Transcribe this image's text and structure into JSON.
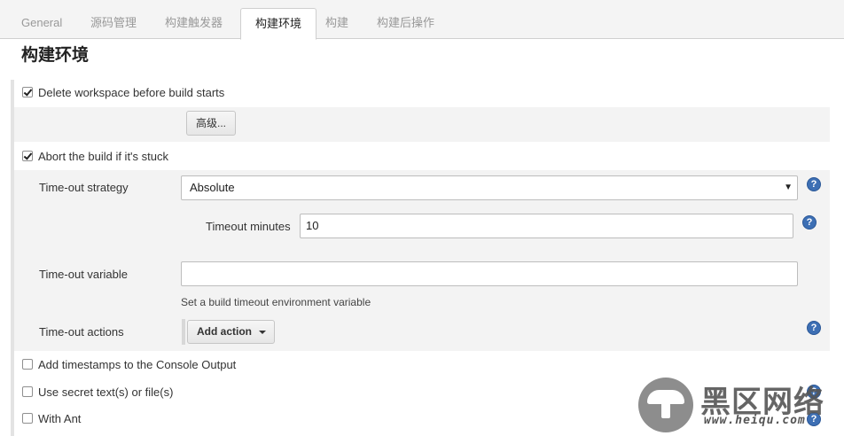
{
  "tabs": [
    {
      "label": "General"
    },
    {
      "label": "源码管理"
    },
    {
      "label": "构建触发器"
    },
    {
      "label": "构建环境"
    },
    {
      "label": "构建"
    },
    {
      "label": "构建后操作"
    }
  ],
  "section_title": "构建环境",
  "delete_workspace": {
    "label": "Delete workspace before build starts",
    "checked": true,
    "advanced_button": "高级..."
  },
  "abort_stuck": {
    "label": "Abort the build if it's stuck",
    "checked": true,
    "timeout_strategy": {
      "label": "Time-out strategy",
      "value": "Absolute"
    },
    "timeout_minutes": {
      "label": "Timeout minutes",
      "value": "10"
    },
    "timeout_variable": {
      "label": "Time-out variable",
      "value": "",
      "hint": "Set a build timeout environment variable"
    },
    "timeout_actions": {
      "label": "Time-out actions",
      "button": "Add action"
    }
  },
  "options": [
    {
      "label": "Add timestamps to the Console Output",
      "checked": false
    },
    {
      "label": "Use secret text(s) or file(s)",
      "checked": false
    },
    {
      "label": "With Ant",
      "checked": false
    }
  ],
  "help_glyph": "?",
  "watermark": {
    "title": "黑区网络",
    "url": "www.heiqu.com"
  },
  "colors": {
    "help_icon": "#3d6fb4",
    "band_bg": "#f3f3f3",
    "tab_bar_bg": "#f4f4f4"
  }
}
